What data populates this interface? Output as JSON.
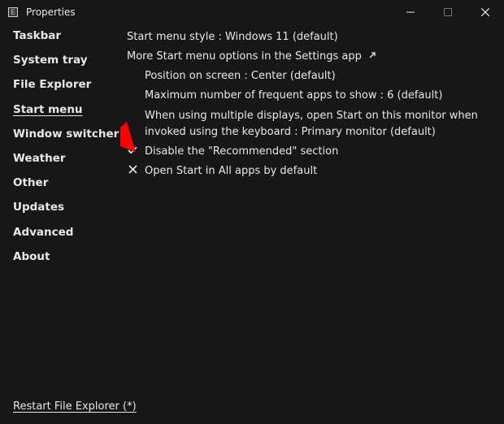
{
  "window": {
    "title": "Properties"
  },
  "sidebar": {
    "items": [
      {
        "label": "Taskbar"
      },
      {
        "label": "System tray"
      },
      {
        "label": "File Explorer"
      },
      {
        "label": "Start menu",
        "active": true
      },
      {
        "label": "Window switcher"
      },
      {
        "label": "Weather"
      },
      {
        "label": "Other"
      },
      {
        "label": "Updates"
      },
      {
        "label": "Advanced"
      },
      {
        "label": "About"
      }
    ]
  },
  "content": {
    "style_line": "Start menu style : Windows 11 (default)",
    "more_options": "More Start menu options in the Settings app",
    "position": "Position on screen : Center (default)",
    "max_frequent": "Maximum number of frequent apps to show : 6 (default)",
    "multi_display": "When using multiple displays, open Start on this monitor when invoked using the keyboard : Primary monitor (default)",
    "disable_recommended": "Disable the \"Recommended\" section",
    "open_all_apps": "Open Start in All apps by default"
  },
  "footer": {
    "restart": "Restart File Explorer (*)"
  }
}
